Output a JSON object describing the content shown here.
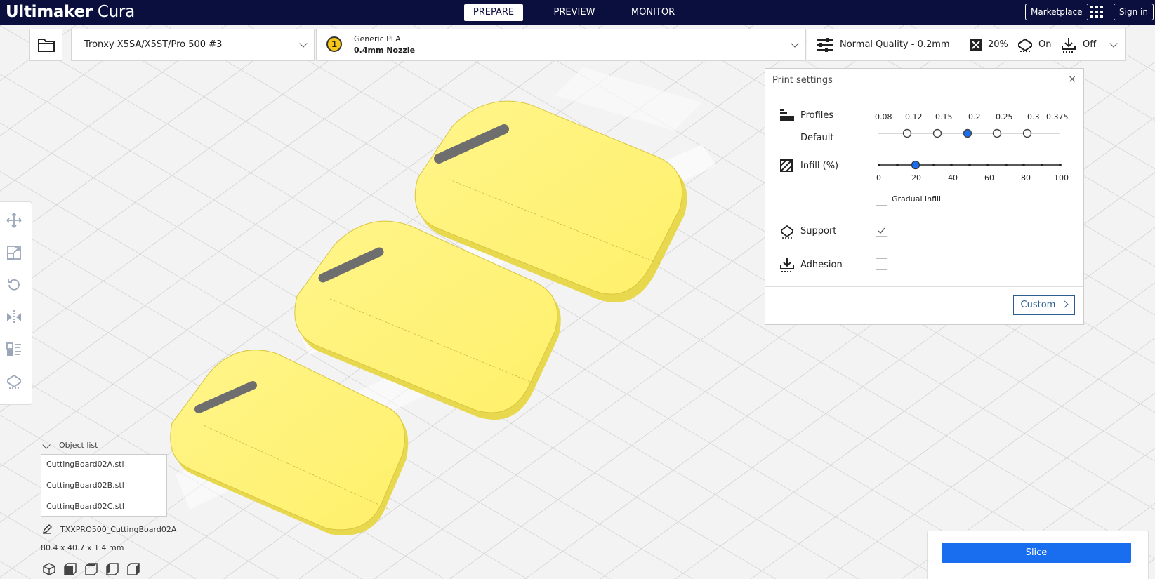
{
  "app": {
    "title_part1": "Ultimaker",
    "title_part2": "Cura"
  },
  "stages": [
    {
      "label": "PREPARE",
      "active": true
    },
    {
      "label": "PREVIEW",
      "active": false
    },
    {
      "label": "MONITOR",
      "active": false
    }
  ],
  "topright": {
    "marketplace": "Marketplace",
    "signin": "Sign in"
  },
  "printer": {
    "name": "Tronxy X5SA/X5ST/Pro 500 #3"
  },
  "material": {
    "extruder": "1",
    "name": "Generic PLA",
    "nozzle": "0.4mm Nozzle"
  },
  "quality": {
    "profile": "Normal Quality - 0.2mm",
    "infill": "20%",
    "support": "On",
    "adhesion": "Off"
  },
  "print_settings": {
    "title": "Print settings",
    "close": "×",
    "profiles_label": "Profiles",
    "default_label": "Default",
    "layer_heights": [
      "0.08",
      "0.12",
      "0.15",
      "0.2",
      "0.25",
      "0.3",
      "0.375"
    ],
    "selected_layer": "0.2",
    "infill_label": "Infill (%)",
    "infill_ticks": [
      "0",
      "20",
      "40",
      "60",
      "80",
      "100"
    ],
    "infill_value": 20,
    "gradual_infill_label": "Gradual infill",
    "gradual_infill": false,
    "support_label": "Support",
    "support_checked": true,
    "adhesion_label": "Adhesion",
    "adhesion_checked": false,
    "custom_label": "Custom"
  },
  "object_list": {
    "title": "Object list",
    "items": [
      "CuttingBoard02A.stl",
      "CuttingBoard02B.stl",
      "CuttingBoard02C.stl"
    ],
    "job_name": "TXXPRO500_CuttingBoard02A",
    "dimensions": "80.4 x 40.7 x 1.4 mm"
  },
  "slice": {
    "label": "Slice"
  },
  "colors": {
    "topbar": "#0a0f3e",
    "accent": "#196ef0",
    "model": "#fff46b"
  }
}
